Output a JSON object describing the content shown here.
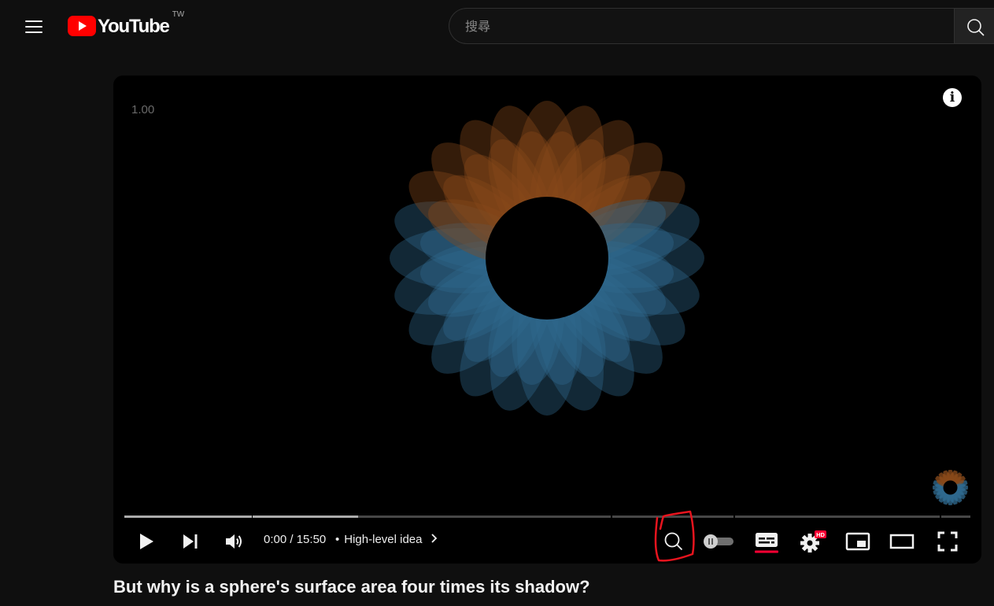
{
  "header": {
    "logo_text": "YouTube",
    "region": "TW",
    "search_placeholder": "搜尋",
    "brand_color": "#ff0000"
  },
  "player": {
    "overlay_value": "1.00",
    "info_label": "i",
    "time_current": "0:00",
    "time_separator": " / ",
    "time_total": "15:50",
    "chapter_bullet": "•",
    "chapter_name": "High-level idea",
    "chapter_arrow": "›",
    "progress_played": 0.0,
    "chapters": [
      {
        "start": 0.0,
        "end": 0.151,
        "buffered": 1.0
      },
      {
        "start": 0.152,
        "end": 0.575,
        "buffered": 0.293
      },
      {
        "start": 0.577,
        "end": 0.72,
        "buffered": 0.0
      },
      {
        "start": 0.722,
        "end": 0.964,
        "buffered": 0.0
      },
      {
        "start": 0.966,
        "end": 1.0,
        "buffered": 0.0
      }
    ],
    "controls": {
      "play_icon": "play-icon",
      "next_icon": "next-icon",
      "volume_icon": "volume-icon",
      "search_icon": "search-in-video-icon",
      "autoplay_icon": "autoplay-toggle-icon",
      "subtitles_icon": "subtitles-icon",
      "settings_icon": "settings-icon",
      "settings_badge": "HD",
      "miniplayer_icon": "miniplayer-icon",
      "theater_icon": "theater-mode-icon",
      "fullscreen_icon": "fullscreen-icon"
    },
    "accent_color": "#ff0033",
    "annotation_color": "#e8141e"
  },
  "video": {
    "title": "But why is a sphere's surface area four times its shadow?"
  }
}
